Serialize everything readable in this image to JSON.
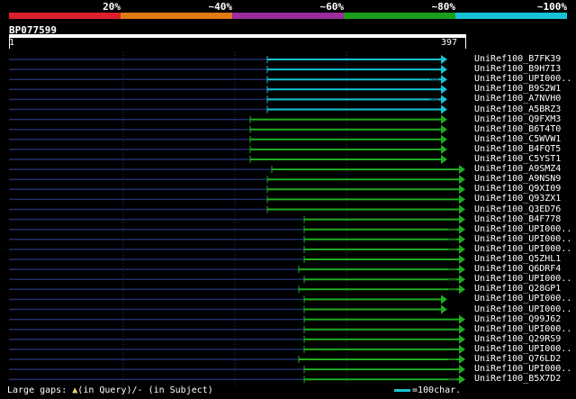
{
  "legend": {
    "colors": [
      "#dd1f2b",
      "#e07a12",
      "#9a2c9c",
      "#1b9e1b",
      "#16c3d6"
    ],
    "labels": [
      "20%",
      "~40%",
      "~60%",
      "~80%",
      "~100%"
    ]
  },
  "query": {
    "id": "BP077599",
    "start": "1",
    "end": "397"
  },
  "hits": [
    {
      "name": "UniRef100_B7FK39",
      "color": "cyan",
      "start": 297,
      "end": 490,
      "dot": false
    },
    {
      "name": "UniRef100_B9H7I3",
      "color": "cyan",
      "start": 297,
      "end": 490,
      "dot": false
    },
    {
      "name": "UniRef100_UPI000..",
      "color": "cyan",
      "start": 297,
      "end": 490,
      "dot": true
    },
    {
      "name": "UniRef100_B9S2W1",
      "color": "cyan",
      "start": 297,
      "end": 490,
      "dot": false
    },
    {
      "name": "UniRef100_A7NVH0",
      "color": "cyan",
      "start": 297,
      "end": 490,
      "dot": true
    },
    {
      "name": "UniRef100_A5BRZ3",
      "color": "cyan",
      "start": 297,
      "end": 490,
      "dot": false
    },
    {
      "name": "UniRef100_Q9FXM3",
      "color": "green",
      "start": 278,
      "end": 490,
      "dot": false
    },
    {
      "name": "UniRef100_B6T4T0",
      "color": "green",
      "start": 278,
      "end": 490,
      "dot": false
    },
    {
      "name": "UniRef100_C5WVW1",
      "color": "green",
      "start": 278,
      "end": 490,
      "dot": false
    },
    {
      "name": "UniRef100_B4FQT5",
      "color": "green",
      "start": 278,
      "end": 490,
      "dot": false
    },
    {
      "name": "UniRef100_C5YST1",
      "color": "green",
      "start": 278,
      "end": 490,
      "dot": false
    },
    {
      "name": "UniRef100_A9SMZ4",
      "color": "green",
      "start": 302,
      "end": 510,
      "dot": false
    },
    {
      "name": "UniRef100_A9NSN9",
      "color": "green",
      "start": 297,
      "end": 510,
      "dot": false
    },
    {
      "name": "UniRef100_Q9XI09",
      "color": "green",
      "start": 297,
      "end": 510,
      "dot": false
    },
    {
      "name": "UniRef100_Q93ZX1",
      "color": "green",
      "start": 297,
      "end": 510,
      "dot": false
    },
    {
      "name": "UniRef100_Q3ED76",
      "color": "green",
      "start": 297,
      "end": 510,
      "dot": false
    },
    {
      "name": "UniRef100_B4F778",
      "color": "green",
      "start": 338,
      "end": 510,
      "dot": false
    },
    {
      "name": "UniRef100_UPI000..",
      "color": "green",
      "start": 338,
      "end": 510,
      "dot": true
    },
    {
      "name": "UniRef100_UPI000..",
      "color": "green",
      "start": 338,
      "end": 510,
      "dot": true
    },
    {
      "name": "UniRef100_UPI000..",
      "color": "green",
      "start": 338,
      "end": 510,
      "dot": true
    },
    {
      "name": "UniRef100_Q5ZHL1",
      "color": "green",
      "start": 338,
      "end": 510,
      "dot": false
    },
    {
      "name": "UniRef100_Q6DRF4",
      "color": "green",
      "start": 332,
      "end": 510,
      "dot": true
    },
    {
      "name": "UniRef100_UPI000..",
      "color": "green",
      "start": 338,
      "end": 510,
      "dot": true
    },
    {
      "name": "UniRef100_Q28GP1",
      "color": "green",
      "start": 332,
      "end": 510,
      "dot": true
    },
    {
      "name": "UniRef100_UPI000..",
      "color": "green",
      "start": 338,
      "end": 490,
      "dot": false
    },
    {
      "name": "UniRef100_UPI000..",
      "color": "green",
      "start": 338,
      "end": 490,
      "dot": false
    },
    {
      "name": "UniRef100_Q99J62",
      "color": "green",
      "start": 338,
      "end": 510,
      "dot": false
    },
    {
      "name": "UniRef100_UPI000..",
      "color": "green",
      "start": 338,
      "end": 510,
      "dot": false
    },
    {
      "name": "UniRef100_Q29RS9",
      "color": "green",
      "start": 338,
      "end": 510,
      "dot": false
    },
    {
      "name": "UniRef100_UPI000..",
      "color": "green",
      "start": 338,
      "end": 510,
      "dot": false
    },
    {
      "name": "UniRef100_Q76LD2",
      "color": "green",
      "start": 332,
      "end": 510,
      "dot": true
    },
    {
      "name": "UniRef100_UPI000..",
      "color": "green",
      "start": 338,
      "end": 510,
      "dot": false
    },
    {
      "name": "UniRef100_B5X7D2",
      "color": "green",
      "start": 338,
      "end": 510,
      "dot": true
    }
  ],
  "footer": {
    "gaps_label": "Large gaps:",
    "gaps_query_symbol": "▲",
    "gaps_query_text": "(in Query)/- (in Subject)",
    "scale_text": "=100char."
  }
}
